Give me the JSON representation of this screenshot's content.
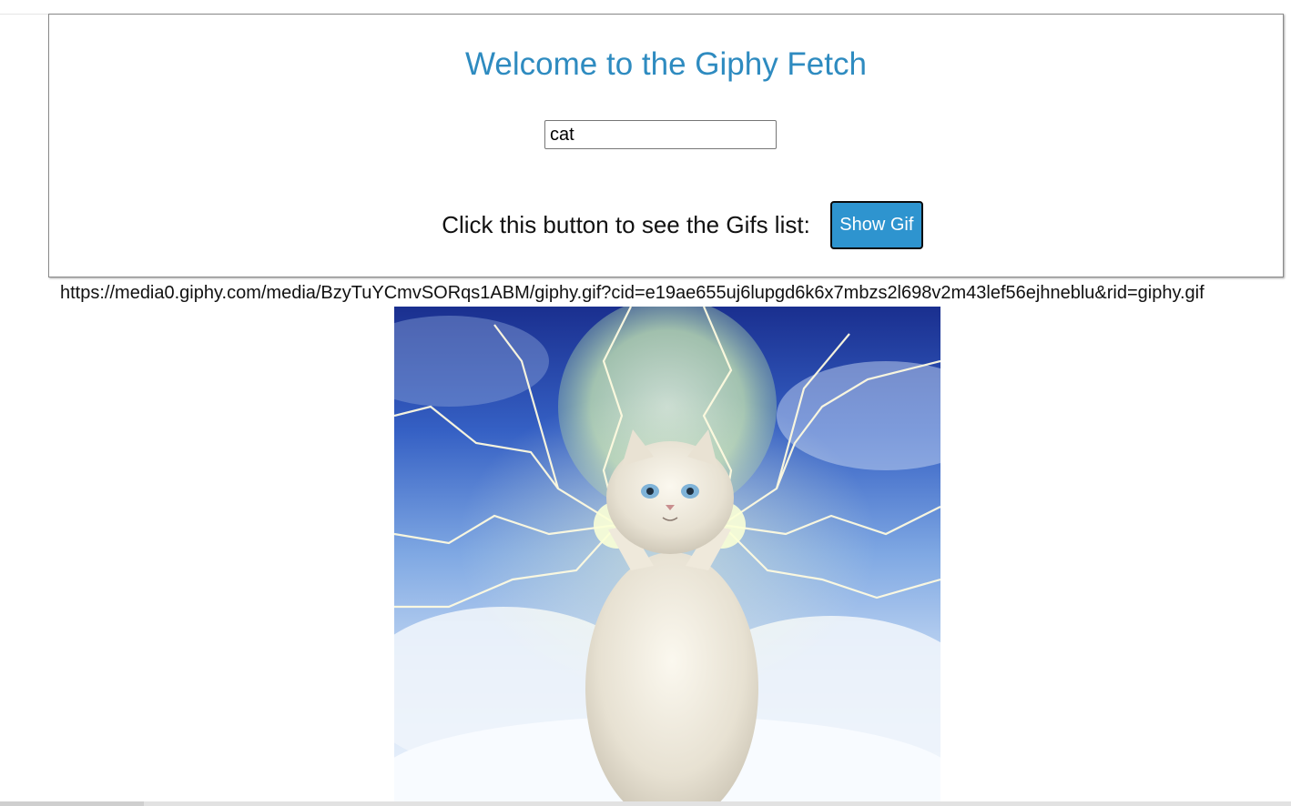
{
  "header": {
    "title": "Welcome to the Giphy Fetch"
  },
  "search": {
    "value": "cat"
  },
  "prompt": {
    "text": "Click this button to see the Gifs list:",
    "button_label": "Show Gif"
  },
  "result": {
    "url": "https://media0.giphy.com/media/BzyTuYCmvSORqs1ABM/giphy.gif?cid=e19ae655uj6lupgd6k6x7mbzs2l698v2m43lef56ejhneblu&rid=giphy.gif"
  },
  "colors": {
    "title": "#2e8bc0",
    "button": "#2e94cf"
  }
}
